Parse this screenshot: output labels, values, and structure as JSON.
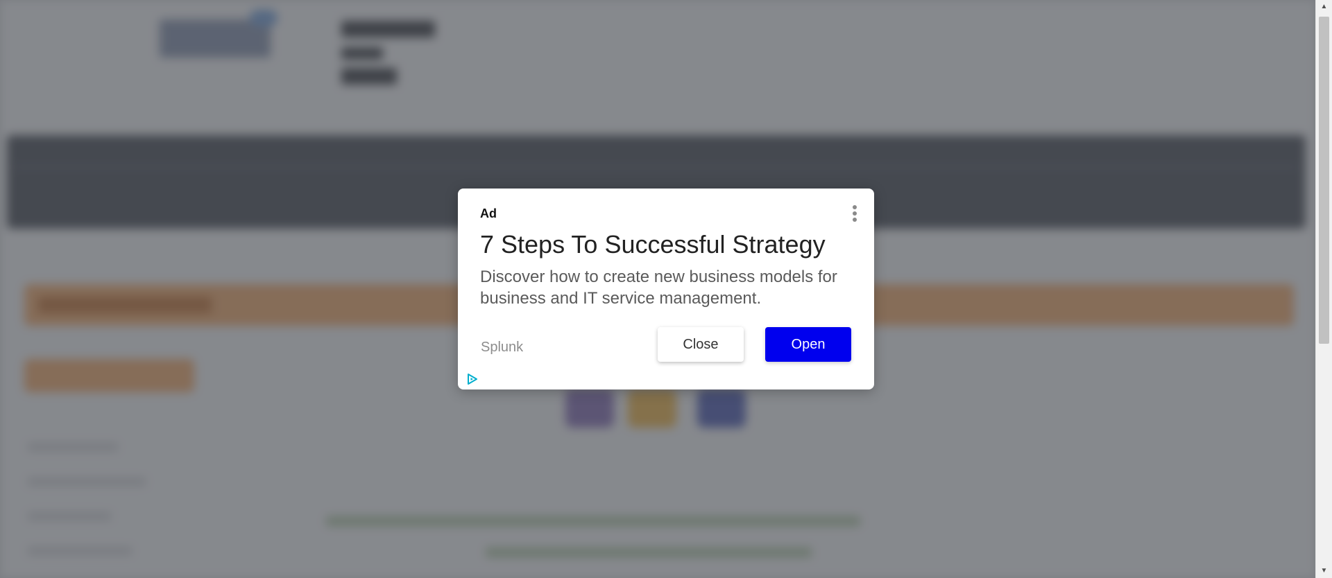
{
  "ad": {
    "label": "Ad",
    "headline": "7 Steps To Successful Strategy",
    "body": "Discover how to create new business models for business and IT service management.",
    "advertiser": "Splunk",
    "close_label": "Close",
    "open_label": "Open",
    "menu_icon": "more-vert-icon",
    "adchoices_icon": "adchoices-icon"
  },
  "colors": {
    "open_button": "#0000ee",
    "overlay": "#4b4e55",
    "adchoices": "#00aecd"
  }
}
